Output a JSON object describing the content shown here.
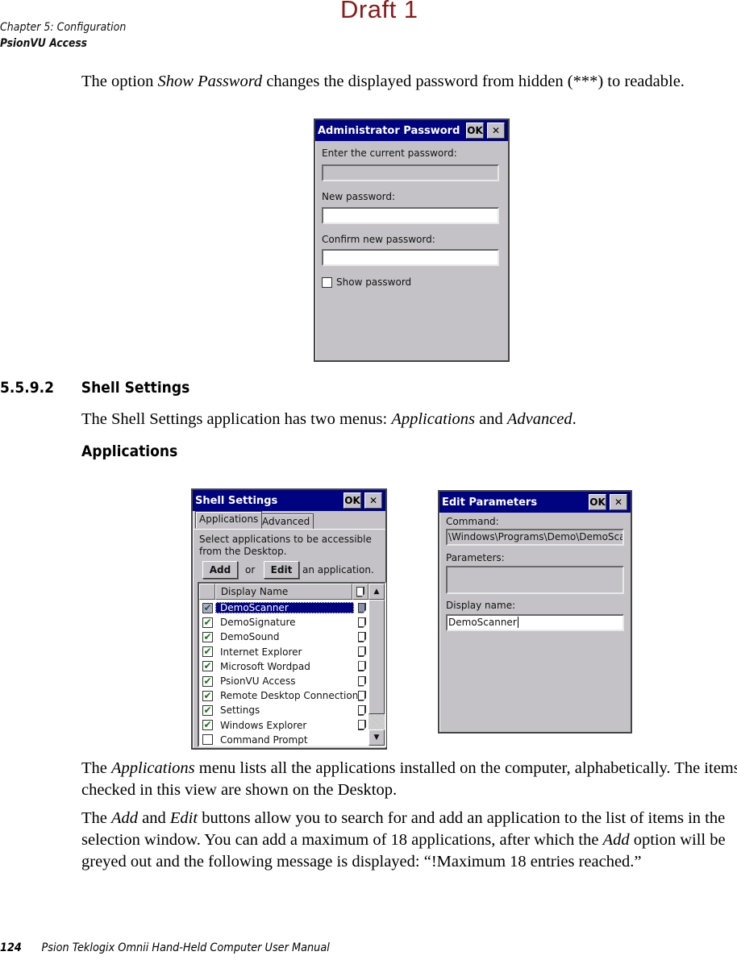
{
  "watermark": "Draft 1",
  "header": {
    "chapter": "Chapter 5:  Configuration",
    "section": "PsionVU Access"
  },
  "intro_paragraph": {
    "before": "The option ",
    "emph": "Show Password",
    "after": " changes the displayed password from hidden (***) to readable."
  },
  "admin_dialog": {
    "title": "Administrator Password",
    "ok_label": "OK",
    "close_label": "✕",
    "current_label": "Enter the current password:",
    "current_value": "",
    "new_label": "New password:",
    "new_value": "",
    "confirm_label": "Confirm new password:",
    "confirm_value": "",
    "show_password_label": "Show password",
    "show_password_checked": false
  },
  "section_heading": {
    "number": "5.5.9.2",
    "title": "Shell Settings"
  },
  "shell_intro": {
    "before": "The Shell Settings application has two menus: ",
    "emph1": "Applications",
    "mid": " and ",
    "emph2": "Advanced",
    "after": "."
  },
  "subheading": "Applications",
  "shell_dialog": {
    "title": "Shell Settings",
    "ok_label": "OK",
    "close_label": "✕",
    "tabs": [
      {
        "label": "Applications",
        "active": true
      },
      {
        "label": "Advanced",
        "active": false
      }
    ],
    "description": "Select applications to be accessible from the Desktop.",
    "add_label": "Add",
    "or_label": "or",
    "edit_label": "Edit",
    "suffix_label": "an application.",
    "column_header": "Display Name",
    "items": [
      {
        "name": "DemoScanner",
        "checked": true,
        "selected": true
      },
      {
        "name": "DemoSignature",
        "checked": true,
        "selected": false
      },
      {
        "name": "DemoSound",
        "checked": true,
        "selected": false
      },
      {
        "name": "Internet Explorer",
        "checked": true,
        "selected": false
      },
      {
        "name": "Microsoft Wordpad",
        "checked": true,
        "selected": false
      },
      {
        "name": "PsionVU Access",
        "checked": true,
        "selected": false
      },
      {
        "name": "Remote Desktop Connection",
        "checked": true,
        "selected": false
      },
      {
        "name": "Settings",
        "checked": true,
        "selected": false
      },
      {
        "name": "Windows Explorer",
        "checked": true,
        "selected": false
      },
      {
        "name": "Command Prompt",
        "checked": false,
        "selected": false
      }
    ]
  },
  "edit_dialog": {
    "title": "Edit Parameters",
    "ok_label": "OK",
    "close_label": "✕",
    "command_label": "Command:",
    "command_value": "\\Windows\\Programs\\Demo\\DemoScan",
    "parameters_label": "Parameters:",
    "parameters_value": "",
    "display_name_label": "Display name:",
    "display_name_value": "DemoScanner"
  },
  "paragraph2": {
    "before": "The ",
    "emph": "Applications",
    "after": " menu lists all the applications installed on the computer, alphabetically. The items checked in this view are shown on the Desktop."
  },
  "paragraph3": {
    "p1": "The ",
    "e1": "Add",
    "p2": " and ",
    "e2": "Edit",
    "p3": " buttons allow you to search for and add an application to the list of items in the selection window. You can add a maximum of 18 applications, after which the ",
    "e3": "Add",
    "p4": " option will be greyed out and the following message is displayed: “!Maximum 18 entries reached.”"
  },
  "footer": {
    "page_number": "124",
    "title": "Psion Teklogix Omnii Hand-Held Computer User Manual"
  }
}
